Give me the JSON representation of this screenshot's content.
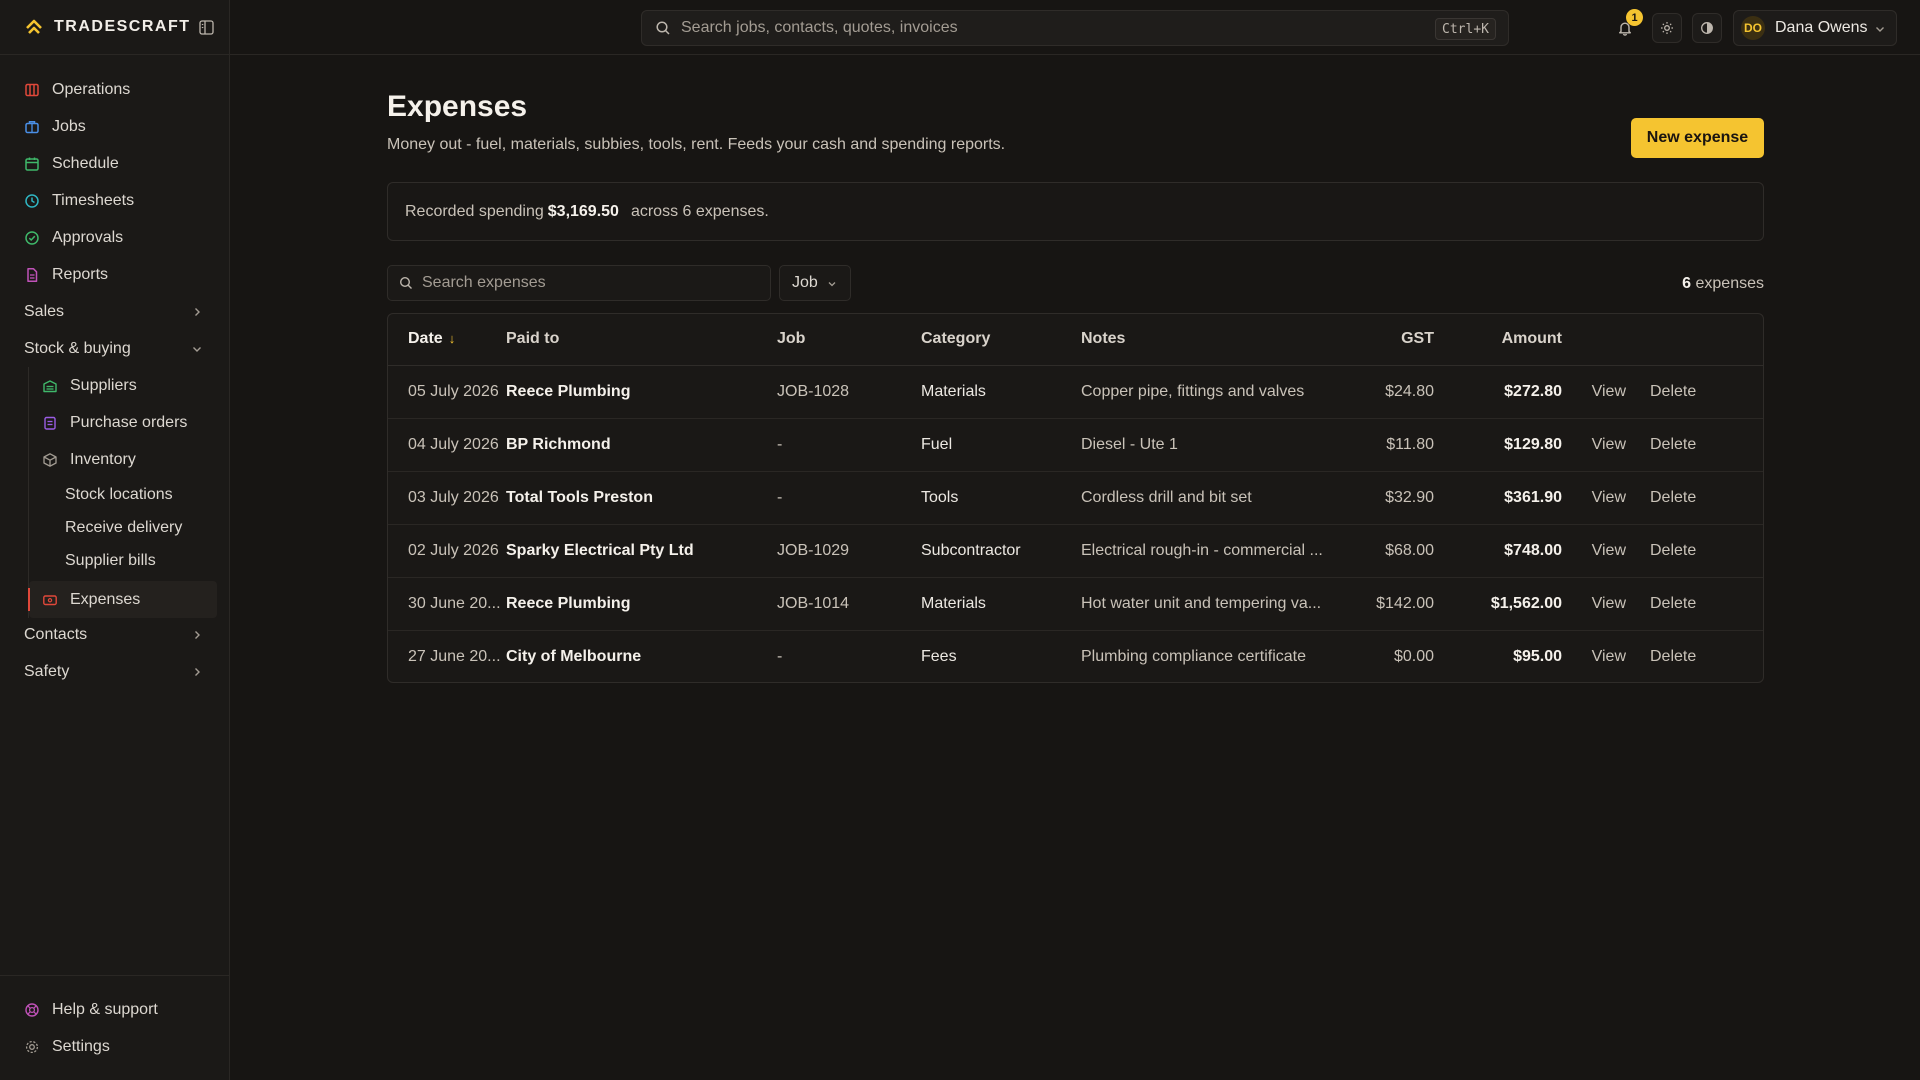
{
  "brand": {
    "name": "TRADESCRAFT"
  },
  "topbar": {
    "search_placeholder": "Search jobs, contacts, quotes, invoices",
    "search_shortcut": "Ctrl+K",
    "notification_count": "1",
    "user": {
      "initials": "DO",
      "name": "Dana Owens"
    }
  },
  "sidebar": {
    "items": [
      {
        "label": "Operations",
        "icon": "operations-icon",
        "color": "#e0483a"
      },
      {
        "label": "Jobs",
        "icon": "briefcase-icon",
        "color": "#4a8fe7"
      },
      {
        "label": "Schedule",
        "icon": "calendar-icon",
        "color": "#3fb86a"
      },
      {
        "label": "Timesheets",
        "icon": "clock-icon",
        "color": "#2fb5c2"
      },
      {
        "label": "Approvals",
        "icon": "check-circle-icon",
        "color": "#3fb86a"
      },
      {
        "label": "Reports",
        "icon": "report-icon",
        "color": "#c052b8"
      }
    ],
    "groups": {
      "sales": "Sales",
      "stock_buying": "Stock & buying",
      "contacts": "Contacts",
      "safety": "Safety"
    },
    "stock_children": {
      "suppliers": {
        "label": "Suppliers",
        "icon": "truck-icon",
        "color": "#3fb86a"
      },
      "purchase_orders": {
        "label": "Purchase orders",
        "icon": "clipboard-icon",
        "color": "#9b5de5"
      },
      "inventory": {
        "label": "Inventory",
        "icon": "package-icon",
        "color": "#a39c93"
      },
      "inventory_children": [
        "Stock locations",
        "Receive delivery",
        "Supplier bills"
      ],
      "expenses": {
        "label": "Expenses",
        "icon": "wallet-icon",
        "color": "#e0483a"
      }
    },
    "footer": {
      "help": {
        "label": "Help & support",
        "icon": "lifebuoy-icon",
        "color": "#c052b8"
      },
      "settings": {
        "label": "Settings",
        "icon": "gear-icon",
        "color": "#a39c93"
      }
    }
  },
  "page": {
    "title": "Expenses",
    "subtitle": "Money out - fuel, materials, subbies, tools, rent. Feeds your cash and spending reports.",
    "new_button": "New expense",
    "summary": {
      "prefix": "Recorded spending",
      "total": "$3,169.50",
      "suffix": "across 6 expenses."
    },
    "search_placeholder": "Search expenses",
    "job_filter": "Job",
    "count_number": "6",
    "count_label": "expenses"
  },
  "table": {
    "headers": [
      "Date",
      "Paid to",
      "Job",
      "Category",
      "Notes",
      "GST",
      "Amount"
    ],
    "action_view": "View",
    "action_delete": "Delete",
    "rows": [
      {
        "date": "05 July 2026",
        "paid_to": "Reece Plumbing",
        "job": "JOB-1028",
        "category": "Materials",
        "notes": "Copper pipe, fittings and valves",
        "gst": "$24.80",
        "amount": "$272.80"
      },
      {
        "date": "04 July 2026",
        "paid_to": "BP Richmond",
        "job": "-",
        "category": "Fuel",
        "notes": "Diesel - Ute 1",
        "gst": "$11.80",
        "amount": "$129.80"
      },
      {
        "date": "03 July 2026",
        "paid_to": "Total Tools Preston",
        "job": "-",
        "category": "Tools",
        "notes": "Cordless drill and bit set",
        "gst": "$32.90",
        "amount": "$361.90"
      },
      {
        "date": "02 July 2026",
        "paid_to": "Sparky Electrical Pty Ltd",
        "job": "JOB-1029",
        "category": "Subcontractor",
        "notes": "Electrical rough-in - commercial ...",
        "gst": "$68.00",
        "amount": "$748.00"
      },
      {
        "date": "30 June 20...",
        "paid_to": "Reece Plumbing",
        "job": "JOB-1014",
        "category": "Materials",
        "notes": "Hot water unit and tempering va...",
        "gst": "$142.00",
        "amount": "$1,562.00"
      },
      {
        "date": "27 June 20...",
        "paid_to": "City of Melbourne",
        "job": "-",
        "category": "Fees",
        "notes": "Plumbing compliance certificate",
        "gst": "$0.00",
        "amount": "$95.00"
      }
    ]
  },
  "colors": {
    "accent": "#f5c430",
    "background": "#171513",
    "active_marker": "#e0483a"
  }
}
